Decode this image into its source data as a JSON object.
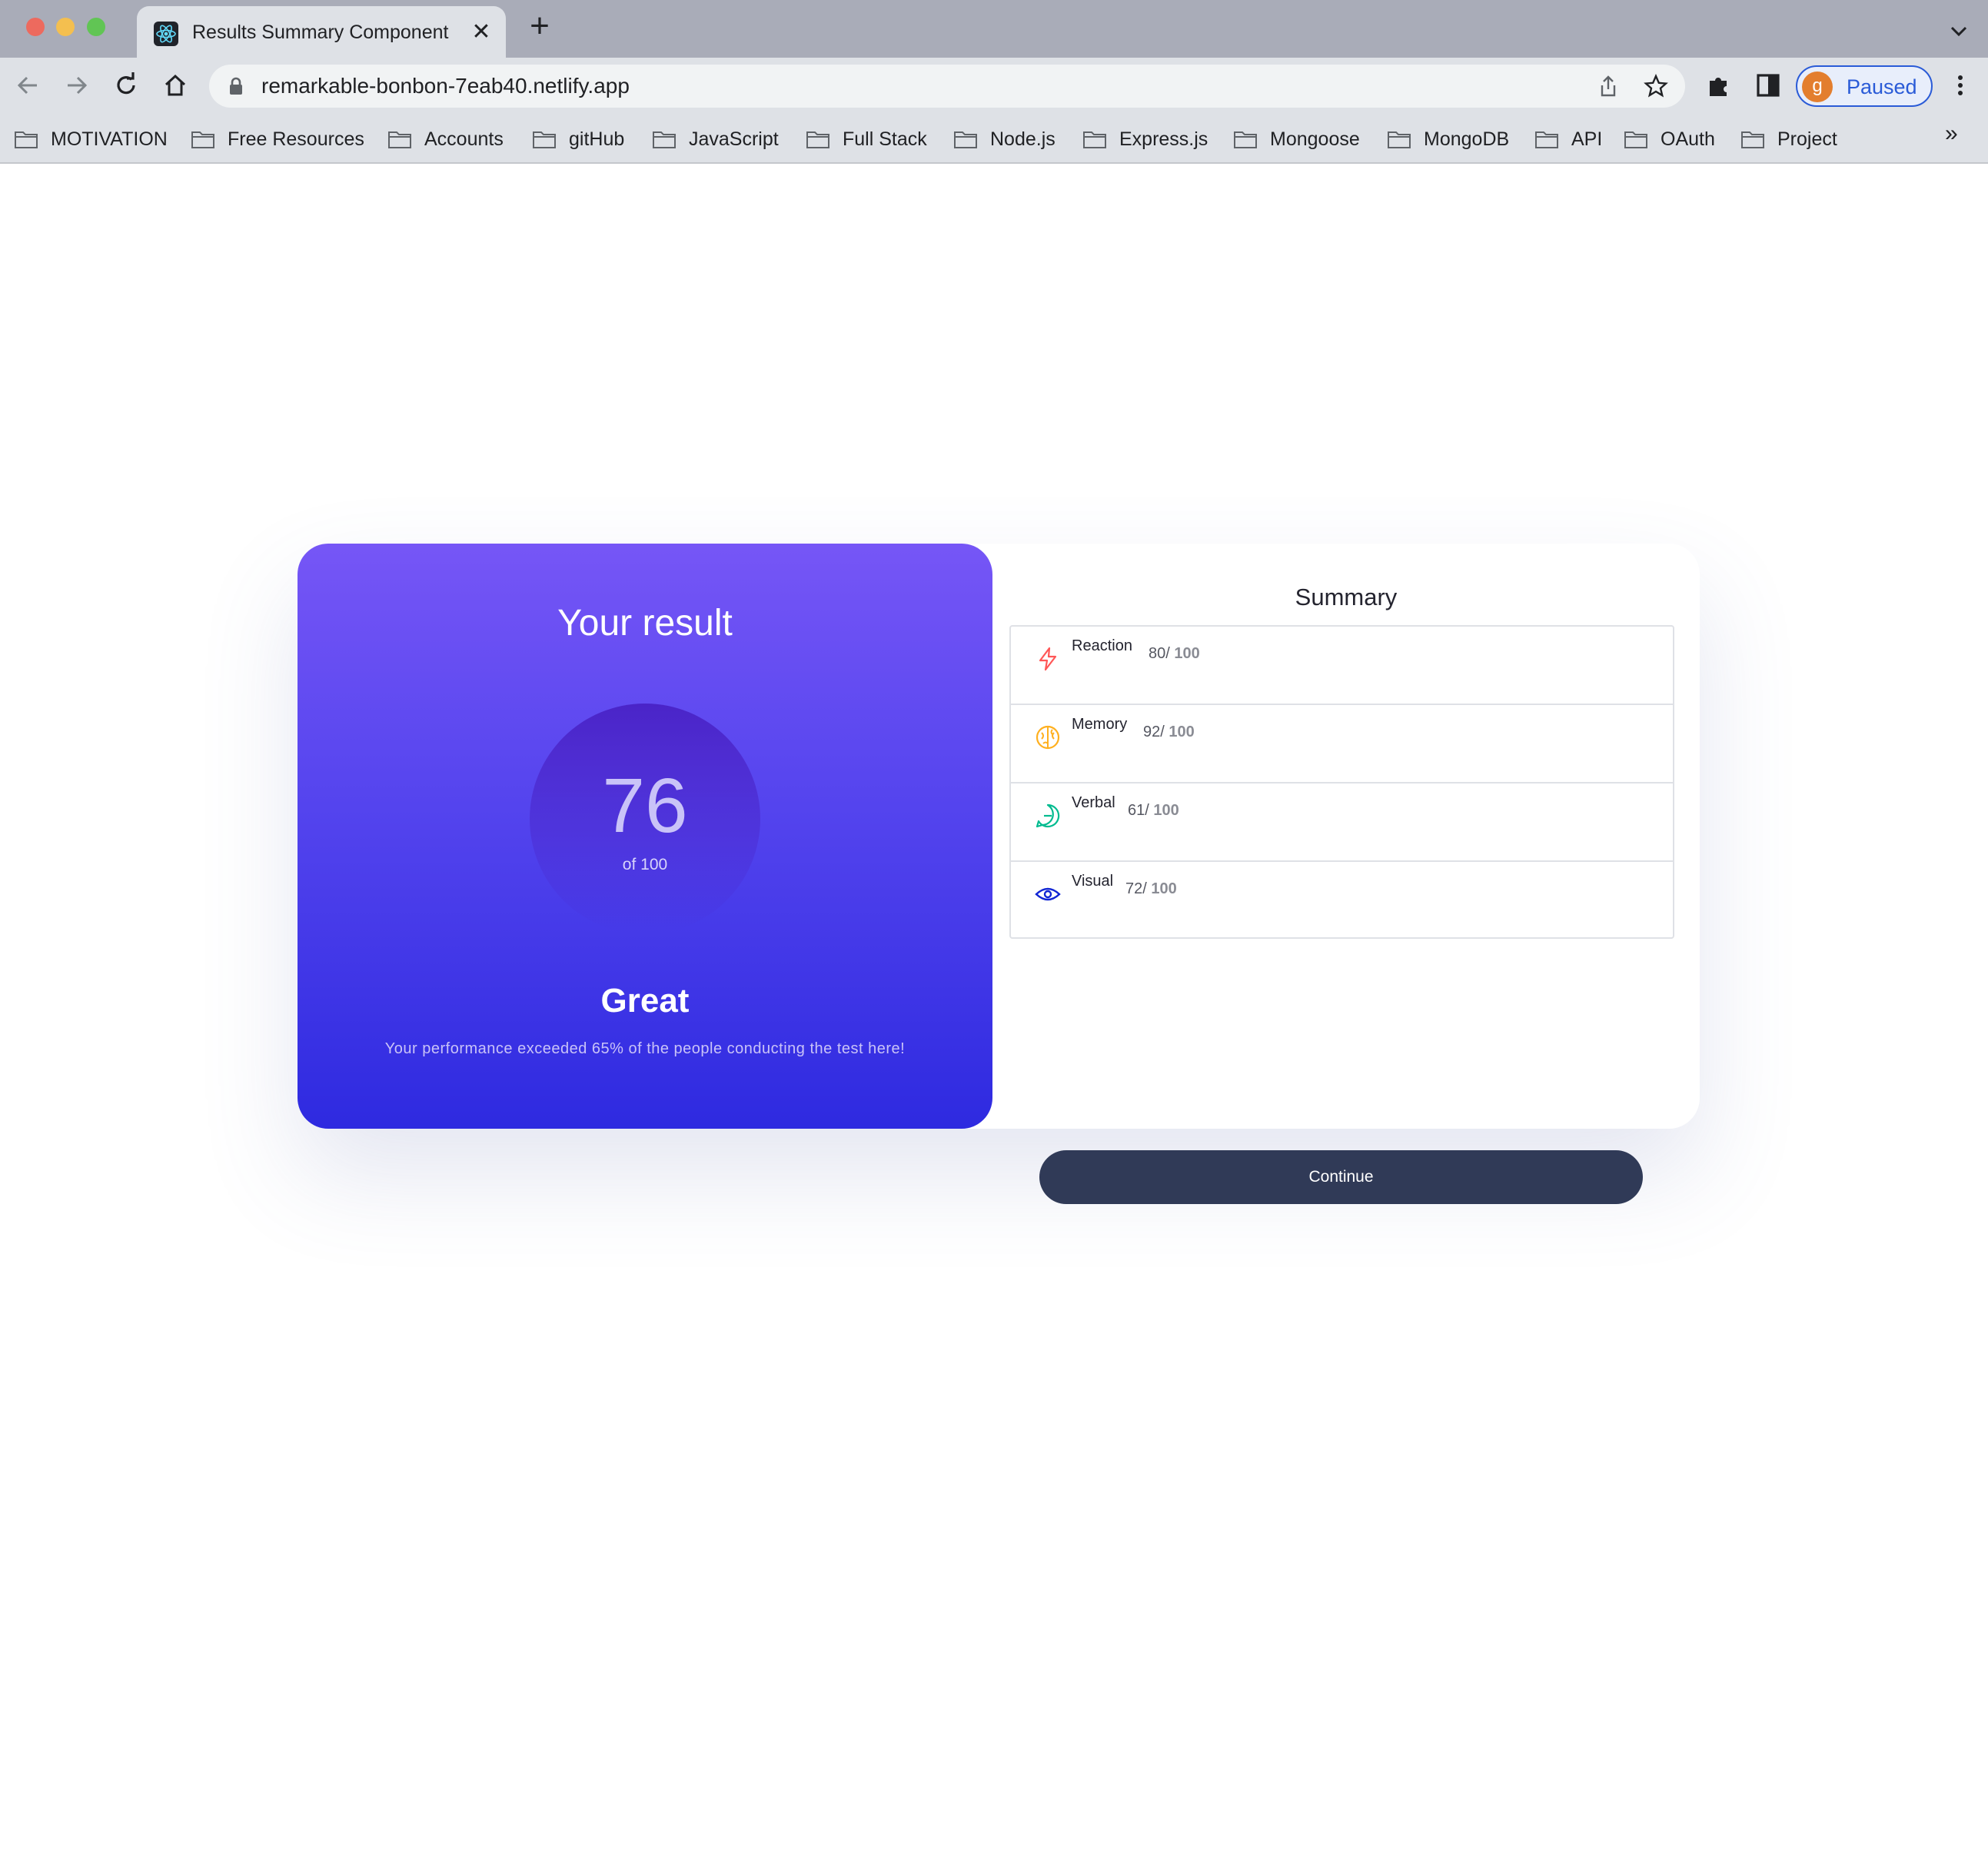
{
  "browser": {
    "tab": {
      "title": "Results Summary Component",
      "favicon": "react-icon"
    },
    "url": "remarkable-bonbon-7eab40.netlify.app",
    "profile": {
      "initial": "g",
      "label": "Paused",
      "color": "#e37e2e"
    },
    "bookmarks": [
      {
        "label": "MOTIVATION"
      },
      {
        "label": "Free Resources"
      },
      {
        "label": "Accounts"
      },
      {
        "label": "gitHub"
      },
      {
        "label": "JavaScript"
      },
      {
        "label": "Full Stack"
      },
      {
        "label": "Node.js"
      },
      {
        "label": "Express.js"
      },
      {
        "label": "Mongoose"
      },
      {
        "label": "MongoDB"
      },
      {
        "label": "API"
      },
      {
        "label": "OAuth"
      },
      {
        "label": "Project"
      }
    ],
    "bookmarks_overflow": "»"
  },
  "result": {
    "title": "Your result",
    "score": "76",
    "of_label": "of 100",
    "verdict": "Great",
    "description": "Your performance exceeded 65% of the people conducting the test here!"
  },
  "summary": {
    "title": "Summary",
    "items": [
      {
        "label": "Reaction",
        "score": "80/",
        "total": " 100",
        "icon": "lightning-icon",
        "color": "#ff5757"
      },
      {
        "label": "Memory",
        "score": "92/",
        "total": " 100",
        "icon": "brain-icon",
        "color": "#ffb01f"
      },
      {
        "label": "Verbal",
        "score": "61/",
        "total": " 100",
        "icon": "chat-bubble-icon",
        "color": "#00bb8f"
      },
      {
        "label": "Visual",
        "score": "72/",
        "total": " 100",
        "icon": "eye-icon",
        "color": "#1125d4"
      }
    ],
    "continue_label": "Continue"
  }
}
